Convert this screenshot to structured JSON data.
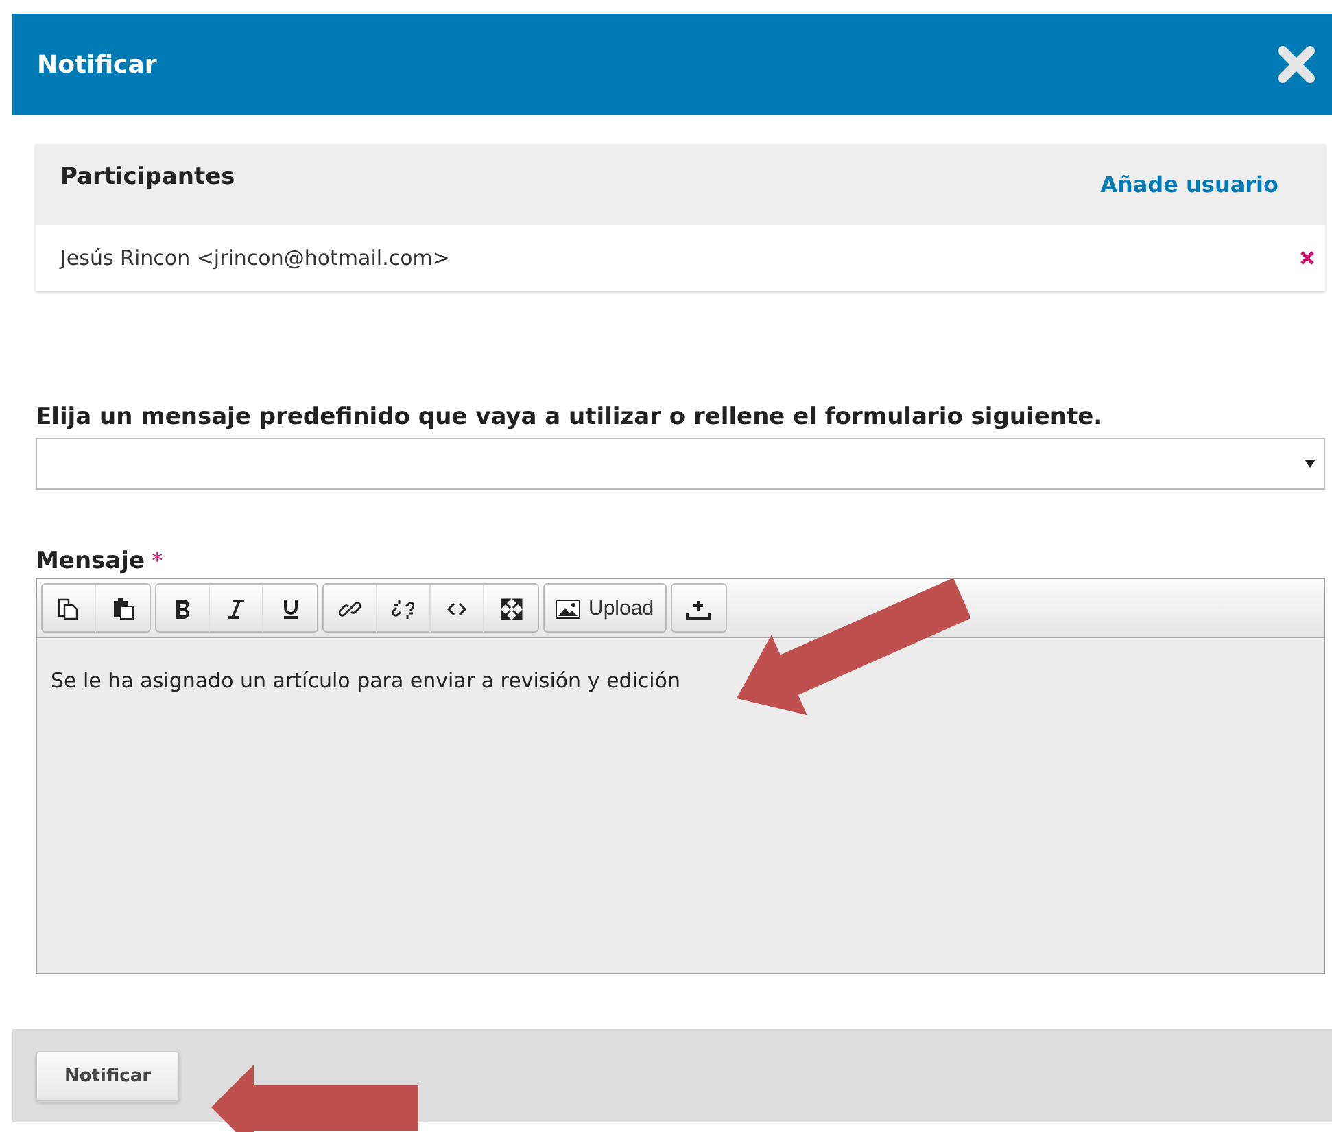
{
  "dialog": {
    "title": "Notificar"
  },
  "participants": {
    "title": "Participantes",
    "add_link": "Añade usuario",
    "items": [
      {
        "name": "Jesús Rincon <jrincon@hotmail.com>"
      }
    ]
  },
  "template_select": {
    "label": "Elija un mensaje predefinido que vaya a utilizar o rellene el formulario siguiente."
  },
  "message": {
    "label": "Mensaje",
    "required_mark": "*",
    "upload_label": "Upload",
    "value": "Se le ha asignado un artículo para enviar a revisión y edición"
  },
  "footer": {
    "submit": "Notificar"
  }
}
